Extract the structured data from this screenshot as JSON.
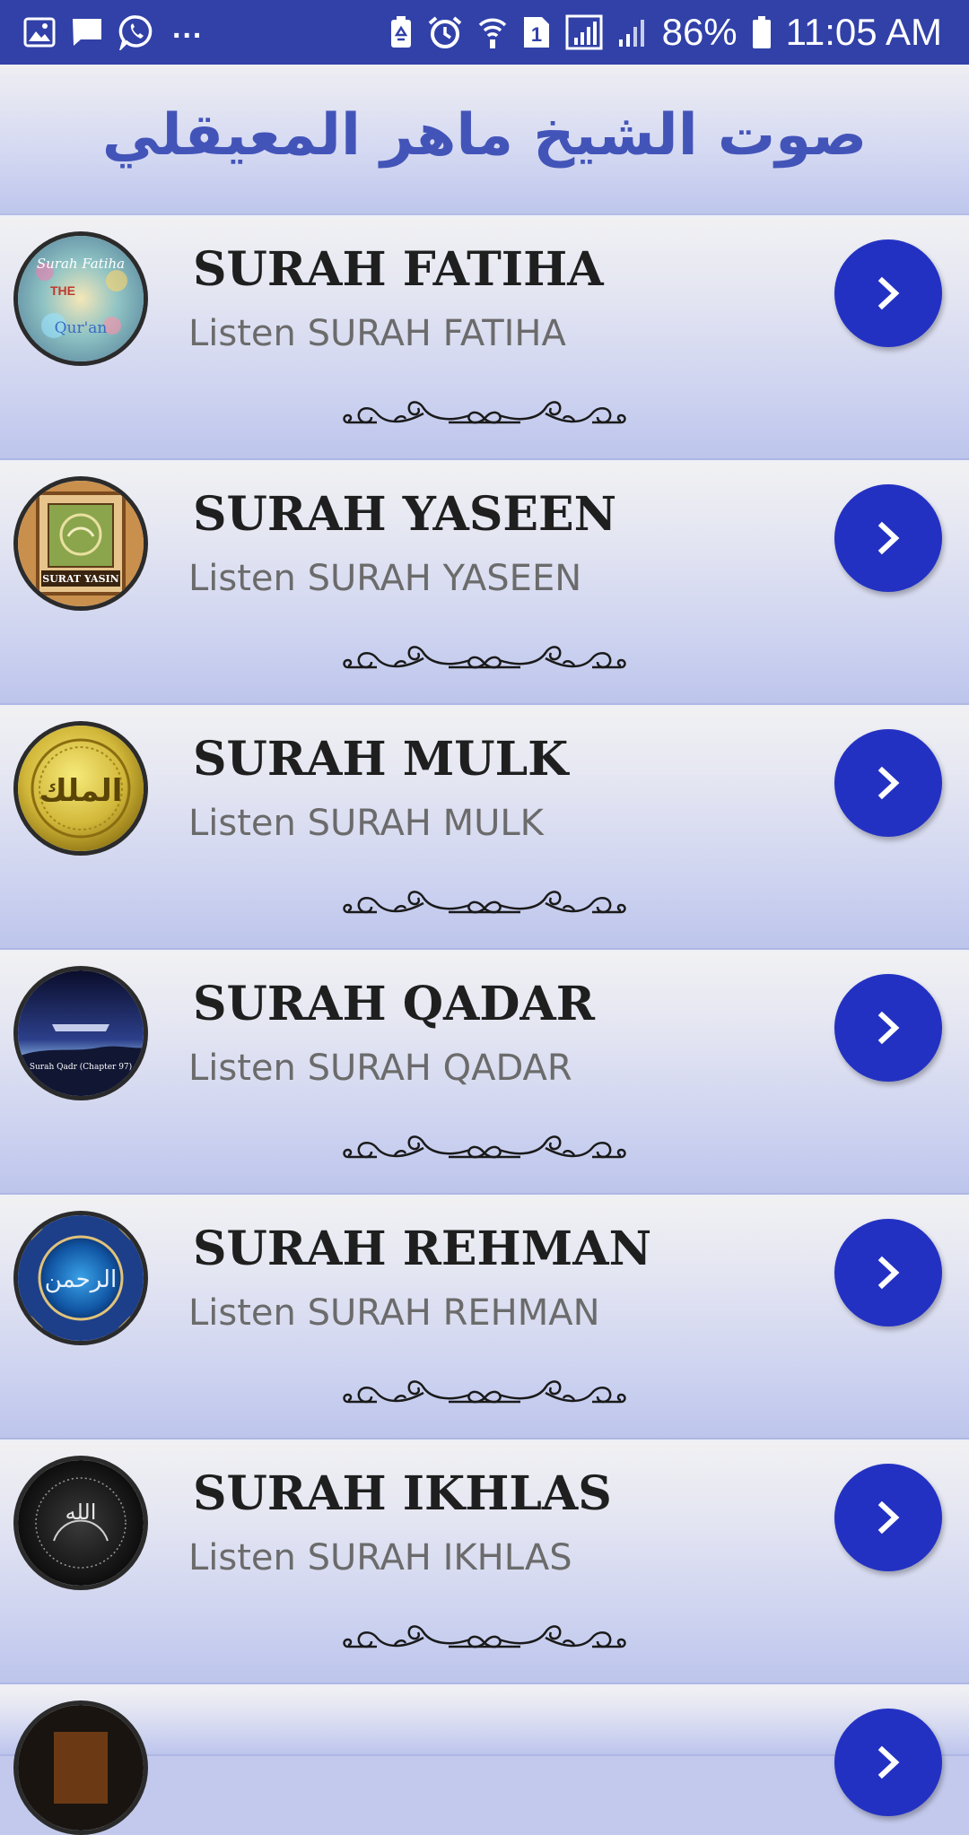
{
  "status_bar": {
    "left_icons": [
      "image-icon",
      "message-icon",
      "whatsapp-icon"
    ],
    "overflow": "...",
    "right_icons": [
      "battery-saver-icon",
      "alarm-icon",
      "wifi-icon",
      "sim-1-icon",
      "signal-icon",
      "signal-2-icon",
      "battery-icon"
    ],
    "sim_label": "1",
    "battery_percent": "86%",
    "time": "11:05 AM"
  },
  "header": {
    "title": "صوت الشيخ ماهر المعيقلي"
  },
  "colors": {
    "status_bar": "#3141a8",
    "title": "#4354b9",
    "button": "#2331c3",
    "row_top": "#f1f1f3",
    "row_bottom": "#bdc5ec"
  },
  "items": [
    {
      "title": "SURAH FATIHA",
      "subtitle": "Listen SURAH FATIHA",
      "thumb_text": [
        "Surah Fatiha",
        "THE",
        "Qur'an"
      ],
      "icon": "chevron-right-icon"
    },
    {
      "title": "SURAH YASEEN",
      "subtitle": "Listen SURAH YASEEN",
      "thumb_text": [
        "SURAT YASIN"
      ],
      "icon": "chevron-right-icon"
    },
    {
      "title": "SURAH MULK",
      "subtitle": "Listen SURAH MULK",
      "thumb_text": [
        "الملك"
      ],
      "icon": "chevron-right-icon"
    },
    {
      "title": "SURAH QADAR",
      "subtitle": "Listen SURAH QADAR",
      "thumb_text": [
        "Surah Qadr (Chapter 97)"
      ],
      "icon": "chevron-right-icon"
    },
    {
      "title": "SURAH REHMAN",
      "subtitle": "Listen SURAH REHMAN",
      "thumb_text": [
        "الرحمن"
      ],
      "icon": "chevron-right-icon"
    },
    {
      "title": "SURAH IKHLAS",
      "subtitle": "Listen SURAH IKHLAS",
      "thumb_text": [
        "الله"
      ],
      "icon": "chevron-right-icon"
    }
  ]
}
